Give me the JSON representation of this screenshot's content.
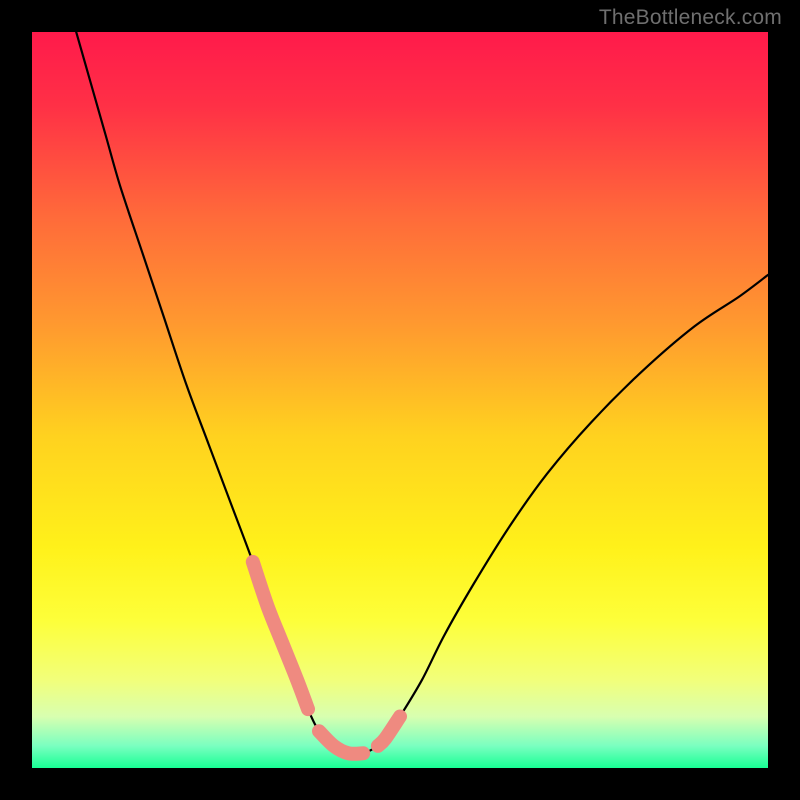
{
  "watermark": "TheBottleneck.com",
  "chart_data": {
    "type": "line",
    "title": "",
    "xlabel": "",
    "ylabel": "",
    "xlim": [
      0,
      100
    ],
    "ylim": [
      0,
      100
    ],
    "grid": false,
    "legend": false,
    "annotations": [],
    "gradient_stops": [
      {
        "offset": 0.0,
        "color": "#ff1a4b"
      },
      {
        "offset": 0.1,
        "color": "#ff3046"
      },
      {
        "offset": 0.25,
        "color": "#ff6a3a"
      },
      {
        "offset": 0.4,
        "color": "#ff9a2f"
      },
      {
        "offset": 0.55,
        "color": "#ffd21f"
      },
      {
        "offset": 0.7,
        "color": "#fff11a"
      },
      {
        "offset": 0.8,
        "color": "#fdff3a"
      },
      {
        "offset": 0.88,
        "color": "#f2ff7a"
      },
      {
        "offset": 0.93,
        "color": "#d8ffb0"
      },
      {
        "offset": 0.97,
        "color": "#7affc0"
      },
      {
        "offset": 1.0,
        "color": "#18ff94"
      }
    ],
    "series": [
      {
        "name": "bottleneck-curve",
        "color": "#000000",
        "x": [
          6,
          8,
          10,
          12,
          15,
          18,
          21,
          24,
          27,
          30,
          32,
          34,
          36,
          37.5,
          39,
          41,
          43,
          45,
          47,
          48,
          50,
          53,
          56,
          60,
          65,
          70,
          76,
          83,
          90,
          96,
          100
        ],
        "y": [
          100,
          93,
          86,
          79,
          70,
          61,
          52,
          44,
          36,
          28,
          22,
          17,
          12,
          8,
          5,
          3,
          2,
          2,
          3,
          4,
          7,
          12,
          18,
          25,
          33,
          40,
          47,
          54,
          60,
          64,
          67
        ]
      },
      {
        "name": "marker-left-descent",
        "color": "#ef8a80",
        "x": [
          30,
          32,
          34,
          36,
          37.5
        ],
        "y": [
          28,
          22,
          17,
          12,
          8
        ]
      },
      {
        "name": "marker-valley-floor",
        "color": "#ef8a80",
        "x": [
          39,
          41,
          43,
          45
        ],
        "y": [
          5,
          3,
          2,
          2
        ]
      },
      {
        "name": "marker-right-ascent",
        "color": "#ef8a80",
        "x": [
          47,
          48,
          50
        ],
        "y": [
          3,
          4,
          7
        ]
      }
    ]
  }
}
